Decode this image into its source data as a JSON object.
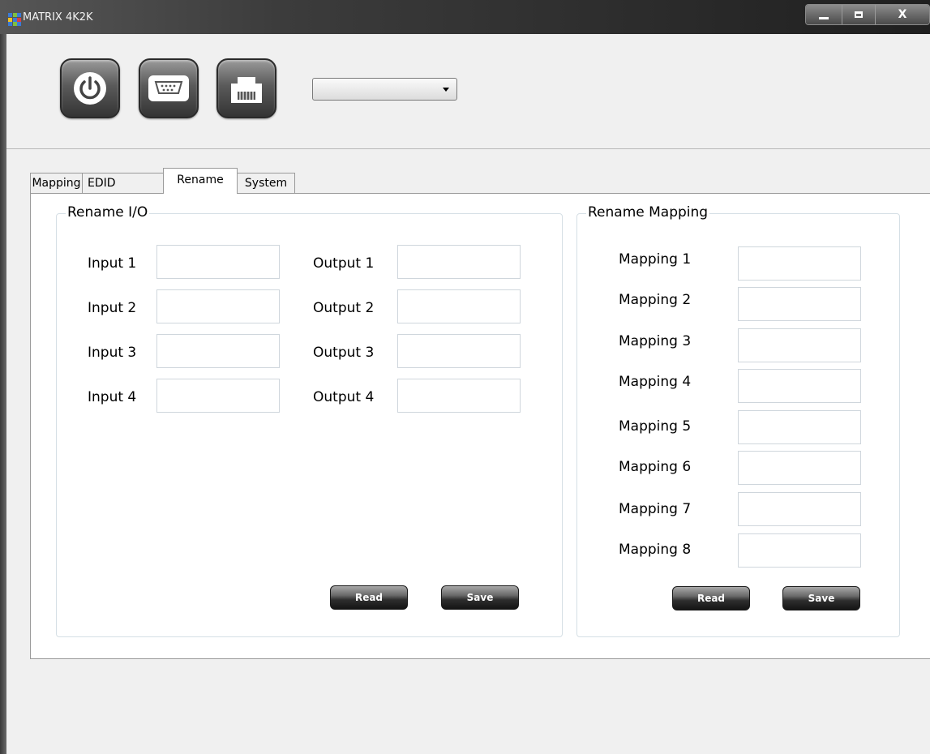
{
  "window": {
    "title": "MATRIX 4K2K",
    "minimize_glyph": "▁",
    "maximize_glyph": "□",
    "close_glyph": "X"
  },
  "toolbar": {
    "icons": [
      "power-icon",
      "serial-port-icon",
      "ethernet-port-icon"
    ],
    "device_select": {
      "value": ""
    }
  },
  "tabs": [
    {
      "label": "Mapping"
    },
    {
      "label": "EDID"
    },
    {
      "label": "Rename",
      "active": true
    },
    {
      "label": "System"
    }
  ],
  "rename_io": {
    "title": "Rename I/O",
    "inputs": [
      {
        "label": "Input 1",
        "value": ""
      },
      {
        "label": "Input 2",
        "value": ""
      },
      {
        "label": "Input 3",
        "value": ""
      },
      {
        "label": "Input 4",
        "value": ""
      }
    ],
    "outputs": [
      {
        "label": "Output 1",
        "value": ""
      },
      {
        "label": "Output 2",
        "value": ""
      },
      {
        "label": "Output 3",
        "value": ""
      },
      {
        "label": "Output 4",
        "value": ""
      }
    ],
    "read_label": "Read",
    "save_label": "Save"
  },
  "rename_mapping": {
    "title": "Rename Mapping",
    "mappings": [
      {
        "label": "Mapping 1",
        "value": ""
      },
      {
        "label": "Mapping 2",
        "value": ""
      },
      {
        "label": "Mapping 3",
        "value": ""
      },
      {
        "label": "Mapping 4",
        "value": ""
      },
      {
        "label": "Mapping 5",
        "value": ""
      },
      {
        "label": "Mapping 6",
        "value": ""
      },
      {
        "label": "Mapping 7",
        "value": ""
      },
      {
        "label": "Mapping 8",
        "value": ""
      }
    ],
    "read_label": "Read",
    "save_label": "Save"
  },
  "colors": {
    "titlebar": "#1f1f1f",
    "window_bg": "#f0f0f0",
    "group_border": "#d5dfe5",
    "button_dark": "#141414"
  }
}
